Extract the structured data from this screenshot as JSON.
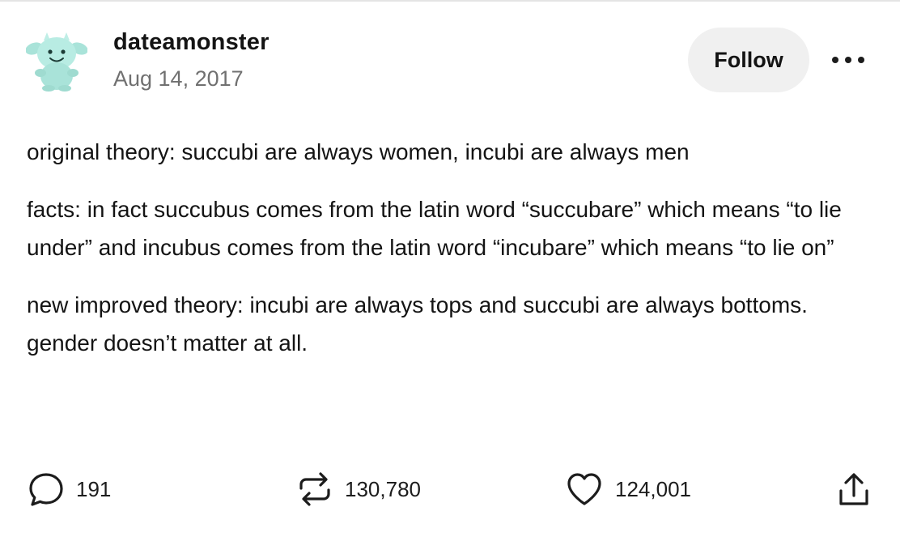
{
  "post": {
    "author": {
      "username": "dateamonster",
      "date": "Aug 14, 2017",
      "avatar_icon": "plush-monster-avatar-icon"
    },
    "actions": {
      "follow_label": "Follow",
      "more_icon": "more-dots-icon"
    },
    "body": [
      "original theory: succubi are always women, incubi are always men",
      "facts: in fact succubus comes from the latin word “succubare” which means “to lie under” and incubus comes from the latin word “incubare” which means “to lie on”",
      "new improved theory: incubi are always tops and succubi are always bottoms. gender doesn’t matter at all."
    ],
    "stats": {
      "comments": "191",
      "reblogs": "130,780",
      "likes": "124,001"
    },
    "icons": {
      "comments": "comment-bubble-icon",
      "reblogs": "reblog-icon",
      "likes": "heart-icon",
      "share": "share-icon"
    }
  },
  "colors": {
    "text": "#141414",
    "muted": "#707070",
    "follow_bg": "#f0f0f0",
    "avatar_teal": "#a9e3d9"
  }
}
